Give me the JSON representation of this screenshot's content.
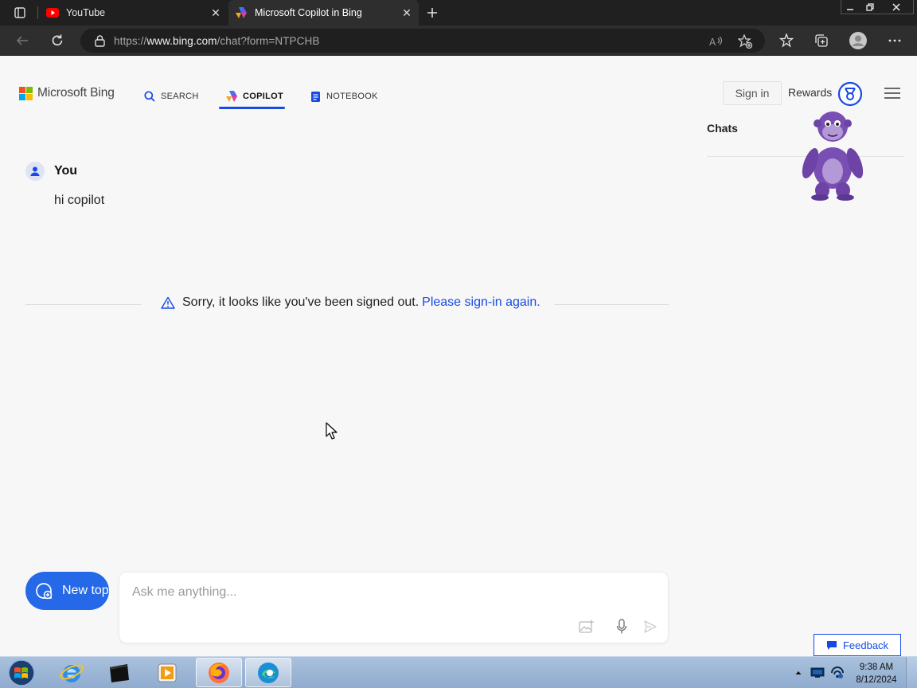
{
  "browser": {
    "tabs": [
      {
        "title": "YouTube",
        "icon": "youtube-icon",
        "active": false
      },
      {
        "title": "Microsoft Copilot in Bing",
        "icon": "copilot-icon",
        "active": true
      }
    ],
    "url_scheme": "https://",
    "url_host": "www.bing.com",
    "url_path": "/chat?form=NTPCHB",
    "colors": {
      "chrome_dark": "#202020",
      "toolbar": "#2e2e2e"
    }
  },
  "bing": {
    "logo_text": "Microsoft Bing",
    "nav": [
      {
        "label": "SEARCH",
        "icon": "search-icon"
      },
      {
        "label": "COPILOT",
        "icon": "copilot-icon",
        "active": true
      },
      {
        "label": "NOTEBOOK",
        "icon": "notebook-icon"
      }
    ],
    "sign_in_label": "Sign in",
    "rewards_label": "Rewards",
    "chats_title": "Chats",
    "colors": {
      "accent": "#174ae4",
      "new_topic_bg": "#2569e8"
    }
  },
  "conversation": {
    "user_name": "You",
    "user_message": "hi copilot",
    "notice_text": "Sorry, it looks like you've been signed out.",
    "notice_link": "Please sign-in again."
  },
  "composer": {
    "new_topic_label": "New topic",
    "placeholder": "Ask me anything..."
  },
  "feedback_label": "Feedback",
  "taskbar": {
    "apps": [
      "internet-explorer-icon",
      "terminal-icon",
      "media-player-icon",
      "firefox-icon",
      "edge-icon"
    ],
    "time": "9:38 AM",
    "date": "8/12/2024"
  }
}
